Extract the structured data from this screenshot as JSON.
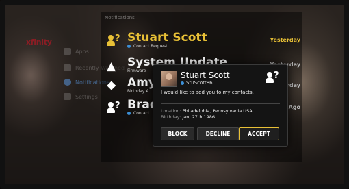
{
  "app": {
    "logo": "xfinity"
  },
  "nav": {
    "items": [
      {
        "label": "Apps",
        "active": false
      },
      {
        "label": "Recently Watched",
        "active": false
      },
      {
        "label": "Notifications",
        "active": true
      },
      {
        "label": "Settings",
        "active": false
      }
    ]
  },
  "notifications": {
    "header": "Notifications",
    "items": [
      {
        "title": "Stuart Scott",
        "subtitle": "Contact Request",
        "when": "Yesterday",
        "icon": "contact-request-icon"
      },
      {
        "title": "System Update",
        "subtitle": "Firmware",
        "when": "Yesterday",
        "icon": "warning-icon"
      },
      {
        "title": "Amy S",
        "subtitle": "Birthday A",
        "when": "Yesterday",
        "icon": "gift-icon"
      },
      {
        "title": "Bradl",
        "subtitle": "Contact",
        "when": "s Ago",
        "icon": "contact-request-icon"
      }
    ]
  },
  "dialog": {
    "name": "Stuart Scott",
    "handle": "StuScott86",
    "message": "I would like to add you to my contacts.",
    "location_label": "Location:",
    "location": "Philadelphia, Pennsylvania USA",
    "birthday_label": "Birthday:",
    "birthday": "Jan, 27th 1986",
    "buttons": {
      "block": "BLOCK",
      "decline": "DECLINE",
      "accept": "ACCEPT"
    }
  },
  "colors": {
    "accent": "#e8c036",
    "brand": "#9b1b24",
    "status_blue": "#3c8fd6"
  }
}
